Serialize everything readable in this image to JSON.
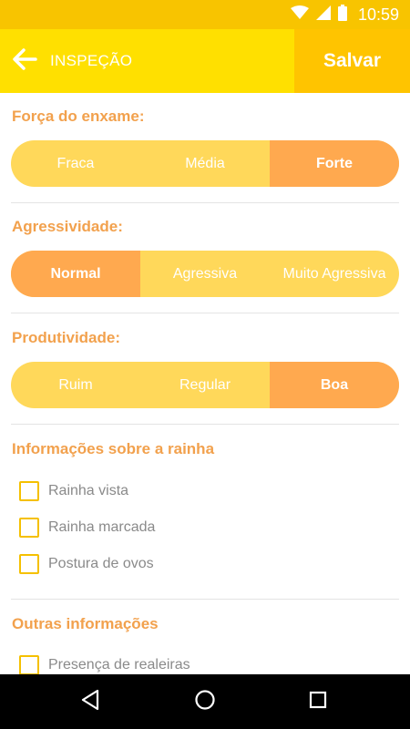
{
  "status_bar": {
    "time": "10:59",
    "icons": [
      "wifi-icon",
      "signal-icon",
      "battery-icon"
    ]
  },
  "app_bar": {
    "title": "INSPEÇÃO",
    "save_label": "Salvar",
    "back_icon": "arrow-left-icon"
  },
  "sections": {
    "forca": {
      "title": "Força do enxame:",
      "options": [
        "Fraca",
        "Média",
        "Forte"
      ],
      "selected": "Forte"
    },
    "agressividade": {
      "title": "Agressividade:",
      "options": [
        "Normal",
        "Agressiva",
        "Muito Agressiva"
      ],
      "selected": "Normal"
    },
    "produtividade": {
      "title": "Produtividade:",
      "options": [
        "Ruim",
        "Regular",
        "Boa"
      ],
      "selected": "Boa"
    },
    "rainha": {
      "title": "Informações sobre a rainha",
      "items": [
        "Rainha vista",
        "Rainha marcada",
        "Postura de ovos"
      ]
    },
    "outras": {
      "title": "Outras informações",
      "items": [
        "Presença de realeiras"
      ]
    }
  },
  "colors": {
    "status_bar": "#f8c400",
    "app_bar": "#ffe000",
    "save_button": "#ffc400",
    "section_title": "#f2a14d",
    "segment_bg": "#ffd85a",
    "segment_active": "#ffa94f",
    "checkbox_border": "#f5c000"
  }
}
